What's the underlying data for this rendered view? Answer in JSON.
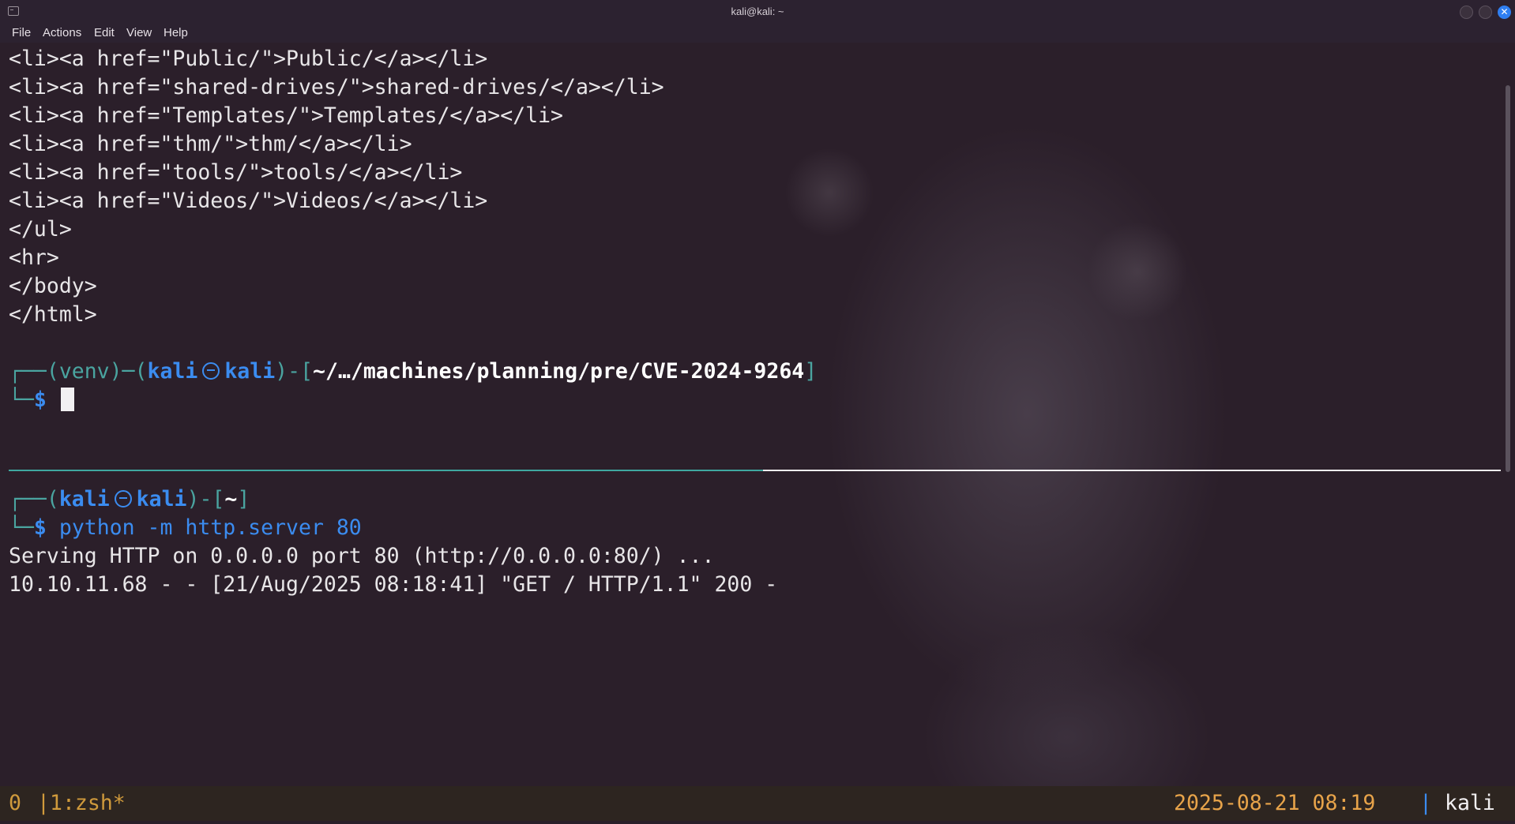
{
  "window": {
    "title": "kali@kali: ~",
    "close_glyph": "✕",
    "icons": {
      "app": "terminal-icon",
      "minimize": "minimize-icon",
      "maximize": "maximize-icon",
      "close": "close-icon"
    }
  },
  "menu": [
    "File",
    "Actions",
    "Edit",
    "View",
    "Help"
  ],
  "pane_top": {
    "output_lines": [
      "<li><a href=\"Public/\">Public/</a></li>",
      "<li><a href=\"shared-drives/\">shared-drives/</a></li>",
      "<li><a href=\"Templates/\">Templates/</a></li>",
      "<li><a href=\"thm/\">thm/</a></li>",
      "<li><a href=\"tools/\">tools/</a></li>",
      "<li><a href=\"Videos/\">Videos/</a></li>",
      "</ul>",
      "<hr>",
      "</body>",
      "</html>"
    ],
    "prompt": {
      "venv_prefix": "┌──(venv)─(",
      "user": "kali",
      "host": "kali",
      "mid": ")-[",
      "path": "~/…/machines/planning/pre/CVE-2024-9264",
      "suffix": "]",
      "second_line": "└─",
      "dollar": "$"
    }
  },
  "pane_bottom": {
    "prompt": {
      "prefix": "┌──(",
      "user": "kali",
      "host": "kali",
      "mid": ")-[",
      "path": "~",
      "suffix": "]",
      "second_line": "└─",
      "dollar": "$",
      "command": "python -m http.server 80"
    },
    "output_lines": [
      "Serving HTTP on 0.0.0.0 port 80 (http://0.0.0.0:80/) ...",
      "10.10.11.68 - - [21/Aug/2025 08:18:41] \"GET / HTTP/1.1\" 200 -"
    ]
  },
  "statusbar": {
    "session": "0",
    "separator": "|",
    "window": "1:zsh*",
    "clock": "2025-08-21 08:19",
    "divider": "|",
    "host": "kali"
  },
  "colors": {
    "accent_blue": "#3b8cf0",
    "prompt_teal": "#4aa4a0",
    "status_orange": "#e8a44a",
    "background": "#2b1f2a"
  }
}
